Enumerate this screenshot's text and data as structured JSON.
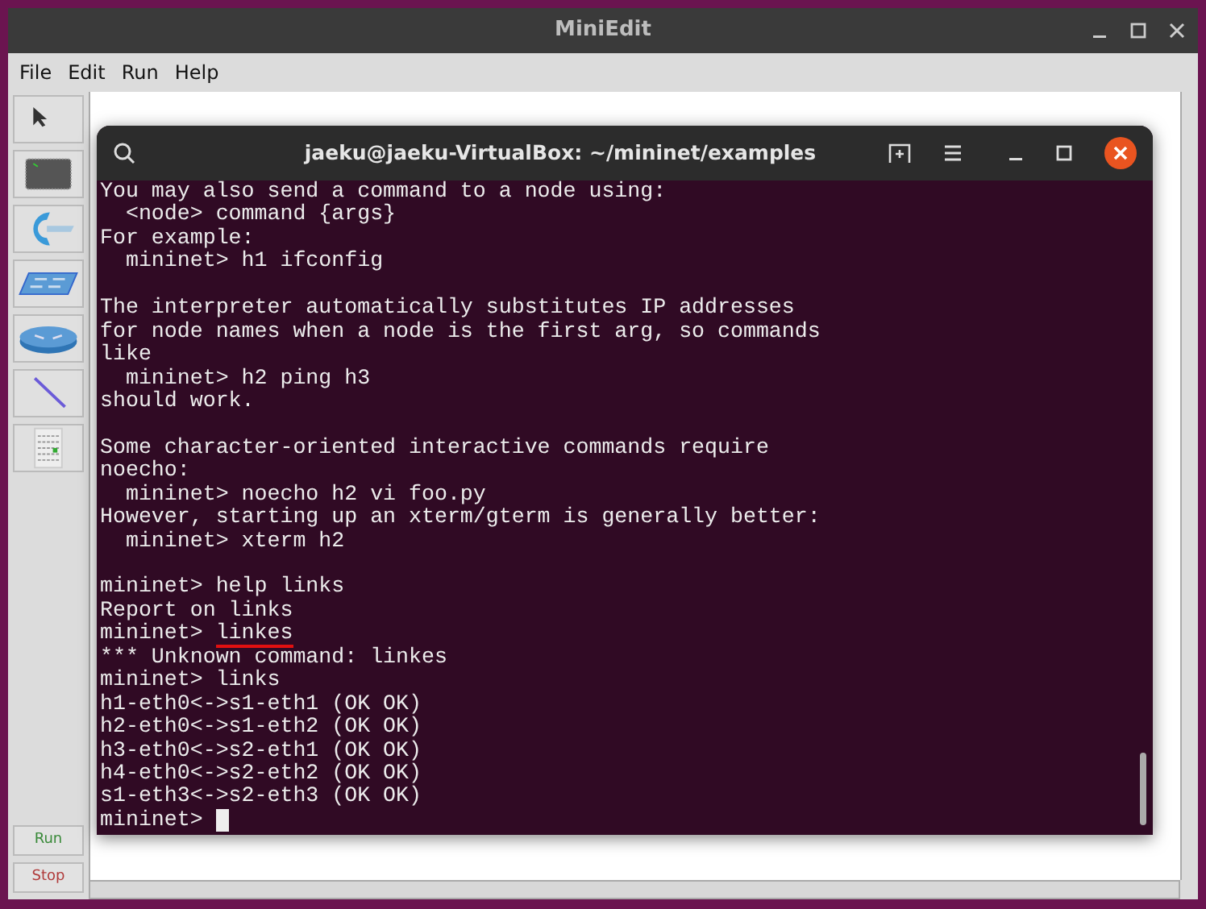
{
  "window": {
    "title": "MiniEdit"
  },
  "menu": [
    "File",
    "Edit",
    "Run",
    "Help"
  ],
  "tools": [
    {
      "kind": "select"
    },
    {
      "kind": "host"
    },
    {
      "kind": "controller"
    },
    {
      "kind": "switch"
    },
    {
      "kind": "router"
    },
    {
      "kind": "link"
    },
    {
      "kind": "netlist"
    }
  ],
  "run_buttons": [
    {
      "label": "Run",
      "kind": "run"
    },
    {
      "label": "Stop",
      "kind": "stop"
    }
  ],
  "terminal": {
    "title": "jaeku@jaeku-VirtualBox: ~/mininet/examples",
    "lines": [
      {
        "kind": "output",
        "text": "You may also send a command to a node using:"
      },
      {
        "kind": "output",
        "text": "  <node> command {args}"
      },
      {
        "kind": "output",
        "text": "For example:"
      },
      {
        "kind": "output",
        "text": "  mininet> h1 ifconfig"
      },
      {
        "kind": "blank"
      },
      {
        "kind": "output",
        "text": "The interpreter automatically substitutes IP addresses"
      },
      {
        "kind": "output",
        "text": "for node names when a node is the first arg, so commands"
      },
      {
        "kind": "output",
        "text": "like"
      },
      {
        "kind": "output",
        "text": "  mininet> h2 ping h3"
      },
      {
        "kind": "output",
        "text": "should work."
      },
      {
        "kind": "blank"
      },
      {
        "kind": "output",
        "text": "Some character-oriented interactive commands require"
      },
      {
        "kind": "output",
        "text": "noecho:"
      },
      {
        "kind": "output",
        "text": "  mininet> noecho h2 vi foo.py"
      },
      {
        "kind": "output",
        "text": "However, starting up an xterm/gterm is generally better:"
      },
      {
        "kind": "output",
        "text": "  mininet> xterm h2"
      },
      {
        "kind": "blank"
      },
      {
        "kind": "prompt",
        "prompt": "mininet>",
        "input": "help links"
      },
      {
        "kind": "output",
        "text": "Report on links"
      },
      {
        "kind": "prompt",
        "prompt": "mininet>",
        "input": "linkes",
        "underlined": true
      },
      {
        "kind": "output",
        "text": "*** Unknown command: linkes"
      },
      {
        "kind": "prompt",
        "prompt": "mininet>",
        "input": "links"
      },
      {
        "kind": "output",
        "text": "h1-eth0<->s1-eth1 (OK OK)"
      },
      {
        "kind": "output",
        "text": "h2-eth0<->s1-eth2 (OK OK)"
      },
      {
        "kind": "output",
        "text": "h3-eth0<->s2-eth1 (OK OK)"
      },
      {
        "kind": "output",
        "text": "h4-eth0<->s2-eth2 (OK OK)"
      },
      {
        "kind": "output",
        "text": "s1-eth3<->s2-eth3 (OK OK)"
      },
      {
        "kind": "prompt",
        "prompt": "mininet>",
        "cursor": true
      }
    ]
  }
}
